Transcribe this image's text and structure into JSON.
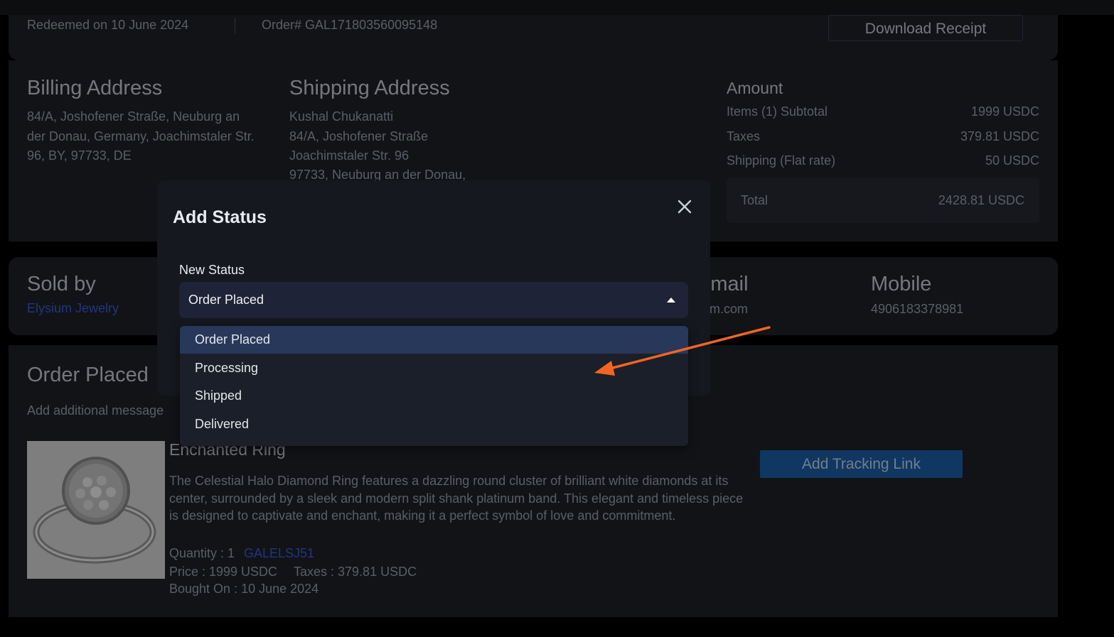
{
  "order_header": {
    "redeemed": "Redeemed on 10 June 2024",
    "order_number": "Order# GAL171803560095148",
    "download_receipt": "Download Receipt"
  },
  "billing": {
    "title": "Billing Address",
    "address": "84/A, Joshofener Straße, Neuburg an der Donau, Germany, Joachimstaler Str. 96, BY, 97733, DE"
  },
  "shipping": {
    "title": "Shipping Address",
    "lines": [
      "Kushal Chukanatti",
      "84/A, Joshofener Straße",
      "Joachimstaler Str. 96",
      "97733, Neuburg an der Donau,"
    ]
  },
  "amount": {
    "title": "Amount",
    "rows": [
      {
        "label": "Items (1) Subtotal",
        "value": "1999 USDC"
      },
      {
        "label": "Taxes",
        "value": "379.81 USDC"
      },
      {
        "label": "Shipping (Flat rate)",
        "value": "50 USDC"
      }
    ],
    "total_label": "Total",
    "total_value": "2428.81 USDC"
  },
  "seller": {
    "sold_by_label": "Sold by",
    "sold_by_value": "Elysium Jewelry",
    "email_label": "Email",
    "email_value": "m.com",
    "mobile_label": "Mobile",
    "mobile_value": "4906183378981"
  },
  "status_section": {
    "title": "Order Placed",
    "add_message": "Add additional message"
  },
  "product": {
    "name": "Enchanted Ring",
    "description": "The Celestial Halo Diamond Ring features a dazzling round cluster of brilliant white diamonds at its center, surrounded by a sleek and modern split shank platinum band. This elegant and timeless piece is designed to captivate and enchant, making it a perfect symbol of love and commitment.",
    "quantity": "Quantity : 1",
    "sku": "GALELSJ51",
    "price": "Price : 1999 USDC",
    "taxes": "Taxes : 379.81 USDC",
    "bought_on": "Bought On : 10 June 2024",
    "add_tracking": "Add Tracking Link"
  },
  "modal": {
    "title": "Add Status",
    "field_label": "New Status",
    "selected": "Order Placed",
    "options": [
      "Order Placed",
      "Processing",
      "Shipped",
      "Delivered"
    ]
  },
  "colors": {
    "page_bg": "#000000",
    "card_bg": "#1f2229",
    "modal_bg": "#15181e",
    "select_bg": "#1e2337",
    "menu_selected": "#27385a",
    "link": "#3b5bdb",
    "tracking_button": "#1d5fa8",
    "annotation_arrow": "#f26522"
  },
  "icons": {
    "close": "close-icon",
    "caret": "caret-up-icon",
    "arrow": "annotation-arrow-icon"
  }
}
